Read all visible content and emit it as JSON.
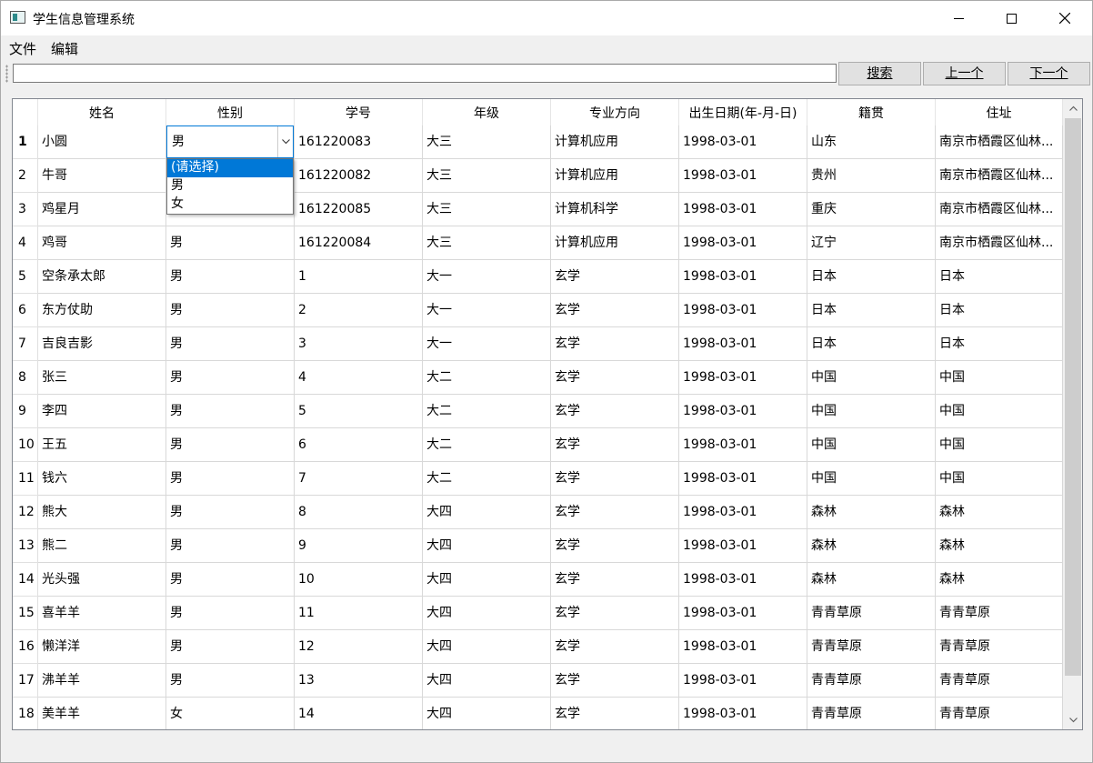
{
  "window": {
    "title": "学生信息管理系统"
  },
  "menu": {
    "file": "文件",
    "edit": "编辑"
  },
  "toolbar": {
    "search_value": "",
    "search_button": "搜索",
    "prev_button": "上一个",
    "next_button": "下一个"
  },
  "table": {
    "columns": [
      "姓名",
      "性别",
      "学号",
      "年级",
      "专业方向",
      "出生日期(年-月-日)",
      "籍贯",
      "住址"
    ],
    "rows": [
      [
        "1",
        "小圆",
        "男",
        "161220083",
        "大三",
        "计算机应用",
        "1998-03-01",
        "山东",
        "南京市栖霞区仙林..."
      ],
      [
        "2",
        "牛哥",
        "男",
        "161220082",
        "大三",
        "计算机应用",
        "1998-03-01",
        "贵州",
        "南京市栖霞区仙林..."
      ],
      [
        "3",
        "鸡星月",
        "男",
        "161220085",
        "大三",
        "计算机科学",
        "1998-03-01",
        "重庆",
        "南京市栖霞区仙林..."
      ],
      [
        "4",
        "鸡哥",
        "男",
        "161220084",
        "大三",
        "计算机应用",
        "1998-03-01",
        "辽宁",
        "南京市栖霞区仙林..."
      ],
      [
        "5",
        "空条承太郎",
        "男",
        "1",
        "大一",
        "玄学",
        "1998-03-01",
        "日本",
        "日本"
      ],
      [
        "6",
        "东方仗助",
        "男",
        "2",
        "大一",
        "玄学",
        "1998-03-01",
        "日本",
        "日本"
      ],
      [
        "7",
        "吉良吉影",
        "男",
        "3",
        "大一",
        "玄学",
        "1998-03-01",
        "日本",
        "日本"
      ],
      [
        "8",
        "张三",
        "男",
        "4",
        "大二",
        "玄学",
        "1998-03-01",
        "中国",
        "中国"
      ],
      [
        "9",
        "李四",
        "男",
        "5",
        "大二",
        "玄学",
        "1998-03-01",
        "中国",
        "中国"
      ],
      [
        "10",
        "王五",
        "男",
        "6",
        "大二",
        "玄学",
        "1998-03-01",
        "中国",
        "中国"
      ],
      [
        "11",
        "钱六",
        "男",
        "7",
        "大二",
        "玄学",
        "1998-03-01",
        "中国",
        "中国"
      ],
      [
        "12",
        "熊大",
        "男",
        "8",
        "大四",
        "玄学",
        "1998-03-01",
        "森林",
        "森林"
      ],
      [
        "13",
        "熊二",
        "男",
        "9",
        "大四",
        "玄学",
        "1998-03-01",
        "森林",
        "森林"
      ],
      [
        "14",
        "光头强",
        "男",
        "10",
        "大四",
        "玄学",
        "1998-03-01",
        "森林",
        "森林"
      ],
      [
        "15",
        "喜羊羊",
        "男",
        "11",
        "大四",
        "玄学",
        "1998-03-01",
        "青青草原",
        "青青草原"
      ],
      [
        "16",
        "懒洋洋",
        "男",
        "12",
        "大四",
        "玄学",
        "1998-03-01",
        "青青草原",
        "青青草原"
      ],
      [
        "17",
        "沸羊羊",
        "男",
        "13",
        "大四",
        "玄学",
        "1998-03-01",
        "青青草原",
        "青青草原"
      ],
      [
        "18",
        "美羊羊",
        "女",
        "14",
        "大四",
        "玄学",
        "1998-03-01",
        "青青草原",
        "青青草原"
      ]
    ],
    "editor": {
      "value": "男",
      "options": [
        "(请选择)",
        "男",
        "女"
      ],
      "highlighted_option": "(请选择)"
    }
  },
  "colors": {
    "accent": "#0078d7",
    "grid_line": "#d8d8d8",
    "background": "#f0f0f0"
  }
}
